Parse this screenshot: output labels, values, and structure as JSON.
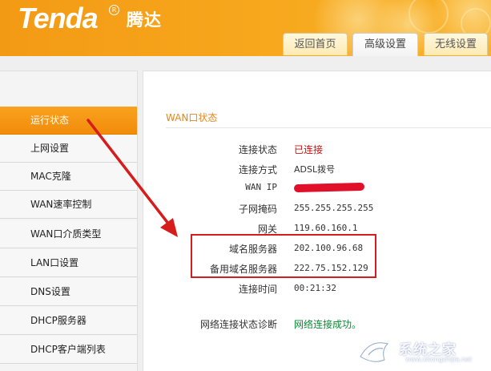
{
  "header": {
    "logo_text": "Tenda",
    "logo_reg": "R",
    "logo_cn": "腾达",
    "tabs": [
      {
        "label": "返回首页",
        "active": false
      },
      {
        "label": "高级设置",
        "active": true
      },
      {
        "label": "无线设置",
        "active": false
      }
    ]
  },
  "sidebar": {
    "items": [
      {
        "label": "运行状态",
        "active": true
      },
      {
        "label": "上网设置",
        "active": false
      },
      {
        "label": "MAC克隆",
        "active": false
      },
      {
        "label": "WAN速率控制",
        "active": false
      },
      {
        "label": "WAN口介质类型",
        "active": false
      },
      {
        "label": "LAN口设置",
        "active": false
      },
      {
        "label": "DNS设置",
        "active": false
      },
      {
        "label": "DHCP服务器",
        "active": false
      },
      {
        "label": "DHCP客户端列表",
        "active": false
      }
    ]
  },
  "content": {
    "section_title": "WAN口状态",
    "rows": [
      {
        "label": "连接状态",
        "value": "已连接"
      },
      {
        "label": "连接方式",
        "value": "ADSL拨号"
      },
      {
        "label": "WAN IP",
        "value": ""
      },
      {
        "label": "子网掩码",
        "value": "255.255.255.255"
      },
      {
        "label": "网关",
        "value": "119.60.160.1"
      },
      {
        "label": "域名服务器",
        "value": "202.100.96.68"
      },
      {
        "label": "备用域名服务器",
        "value": "222.75.152.129"
      },
      {
        "label": "连接时间",
        "value": "00:21:32"
      }
    ],
    "diagnosis": {
      "label": "网络连接状态诊断",
      "value": "网络连接成功。"
    }
  },
  "watermark": {
    "text": "系统之家",
    "url": "www.xitongzhijia.net"
  },
  "colors": {
    "brand_orange": "#f39a14",
    "section_title": "#e3871a",
    "status_red": "#cc1010",
    "status_green": "#0a8a33",
    "annotation_red": "#d61c1c"
  }
}
